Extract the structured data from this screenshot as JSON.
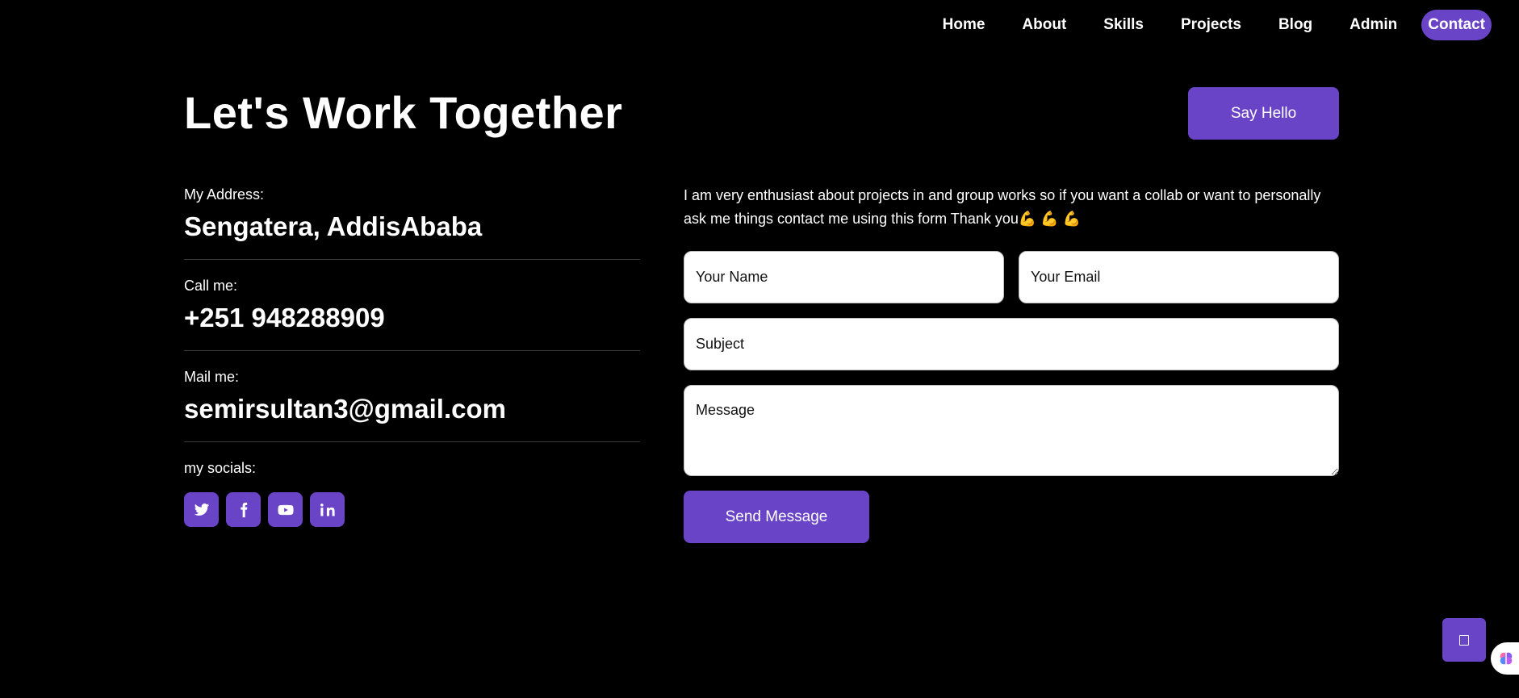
{
  "nav": {
    "items": [
      {
        "label": "Home"
      },
      {
        "label": "About"
      },
      {
        "label": "Skills"
      },
      {
        "label": "Projects"
      },
      {
        "label": "Blog"
      },
      {
        "label": "Admin"
      },
      {
        "label": "Contact",
        "active": true
      }
    ]
  },
  "hero": {
    "title": "Let's Work Together",
    "say_hello_label": "Say Hello"
  },
  "info": {
    "address_label": "My Address:",
    "address_value": "Sengatera, AddisAbaba",
    "phone_label": "Call me:",
    "phone_value": "+251 948288909",
    "mail_label": "Mail me:",
    "mail_value": "semirsultan3@gmail.com",
    "socials_label": "my socials:",
    "socials": [
      "twitter-icon",
      "facebook-icon",
      "youtube-icon",
      "linkedin-icon"
    ]
  },
  "form": {
    "intro": "I am very enthusiast about projects in and group works so if you want a collab or want to personally ask me things contact me using this form Thank you💪 💪 💪",
    "name_placeholder": "Your Name",
    "email_placeholder": "Your Email",
    "subject_placeholder": "Subject",
    "message_placeholder": "Message",
    "send_label": "Send Message"
  },
  "colors": {
    "accent": "#6a44c7",
    "background": "#000000",
    "text": "#ffffff"
  }
}
